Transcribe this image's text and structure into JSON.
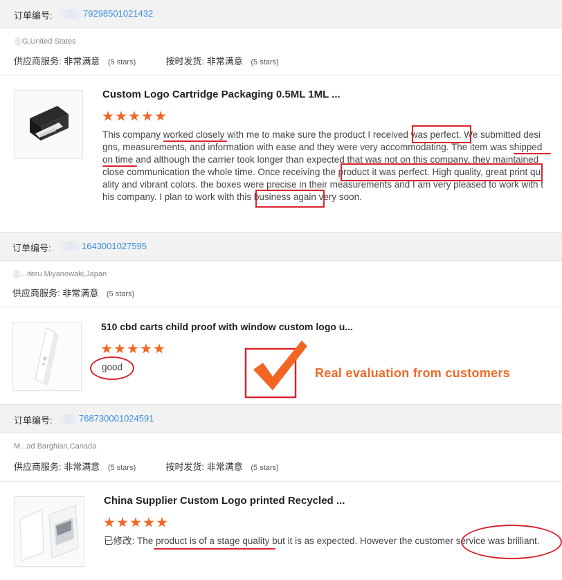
{
  "orders": [
    {
      "order_label": "订单编号:",
      "order_number_visible": "79298501021432",
      "buyer": "G,United States",
      "supplier_service_label": "供应商服务:",
      "supplier_service_value": "非常满意",
      "supplier_service_stars": "(5 stars)",
      "ontime_label": "按时发货:",
      "ontime_value": "非常满意",
      "ontime_stars": "(5 stars)",
      "product_title": "Custom Logo Cartridge Packaging 0.5ML 1ML ...",
      "rating": 5,
      "review_lines": [
        "This company worked closely with me to make sure the product I received was perfect. We submitted desi",
        "gns, measurements, and information with ease and they were very accommodating. The item was shipped",
        "on time and although the carrier took longer than expected that was not on this company, they maintained",
        "close communication the whole time. Once receiving the product it was perfect. High quality, great print qu",
        "ality and vibrant colors. the boxes were precise in their measurements and I am very pleased to work with t",
        "his company. I plan to work with this business again very soon."
      ]
    },
    {
      "order_label": "订单编号:",
      "order_number_visible": "1643001027595",
      "buyer": "...iteru Miyanowaki,Japan",
      "supplier_service_label": "供应商服务:",
      "supplier_service_value": "非常满意",
      "supplier_service_stars": "(5 stars)",
      "product_title": "510 cbd carts child proof with window custom logo u...",
      "rating": 5,
      "review": "good"
    },
    {
      "order_label": "订单编号:",
      "order_number_visible": "768730001024591",
      "buyer": "M...ad Barghian,Canada",
      "supplier_service_label": "供应商服务:",
      "supplier_service_value": "非常满意",
      "supplier_service_stars": "(5 stars)",
      "ontime_label": "按时发货:",
      "ontime_value": "非常满意",
      "ontime_stars": "(5 stars)",
      "product_title": "China Supplier Custom Logo printed Recycled ...",
      "rating": 5,
      "review_prefix": "已修改:",
      "review": "The product is of a stage quality but it is as expected. However the customer service was brilliant."
    }
  ],
  "promo": {
    "text": "Real evaluation from customers"
  },
  "colors": {
    "accent_link": "#3a8ee6",
    "star": "#f26522",
    "annotation_red": "#d9242f",
    "promo_orange": "#f06a28"
  },
  "icons": {
    "check": "checkmark-icon",
    "star": "star-icon"
  }
}
